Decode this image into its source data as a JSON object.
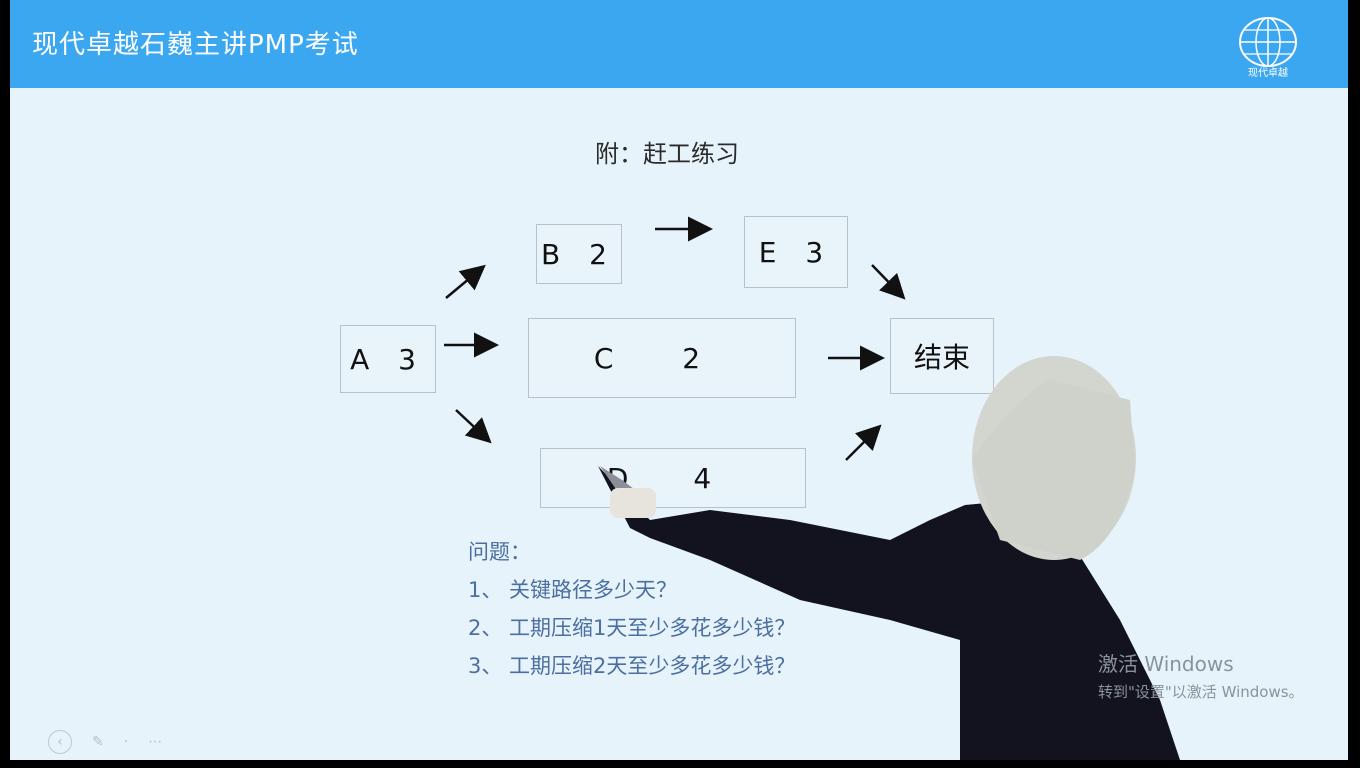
{
  "header": {
    "course_title": "现代卓越石巍主讲PMP考试",
    "logo_caption": "现代卓越"
  },
  "slide": {
    "title": "附：赶工练习"
  },
  "nodes": {
    "a": "A 3",
    "b": "B 2",
    "c": "C 2",
    "d": "D 4",
    "e": "E 3",
    "end": "结束"
  },
  "questions": {
    "heading": "问题：",
    "q1": "1、 关键路径多少天？",
    "q2": "2、 工期压缩1天至少多花多少钱？",
    "q3": "3、 工期压缩2天至少多花多少钱？"
  },
  "watermark": {
    "line1": "激活 Windows",
    "line2": "转到\"设置\"以激活 Windows。"
  },
  "colors": {
    "header_bg": "#3aa7f0",
    "slide_bg": "#e7f3fa",
    "question_text": "#4b6fa0"
  }
}
